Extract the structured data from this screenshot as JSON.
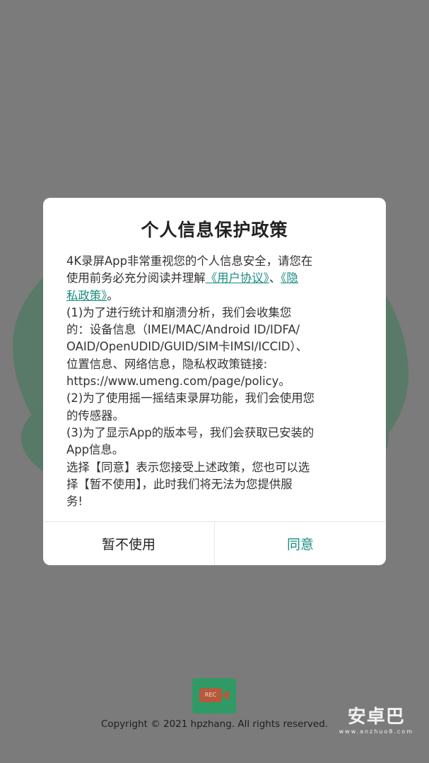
{
  "dialog": {
    "title": "个人信息保护政策",
    "body_lines": [
      {
        "parts": [
          {
            "text": "4K录屏App非常重视您的个人信息安全，请您在"
          }
        ]
      },
      {
        "parts": [
          {
            "text": "使用前务必充分阅读并理解"
          },
          {
            "text": "《用户协议》",
            "link": true
          },
          {
            "text": "、"
          },
          {
            "text": "《隐",
            "link": true
          }
        ]
      },
      {
        "parts": [
          {
            "text": "私政策》",
            "link": true
          },
          {
            "text": "。"
          }
        ]
      },
      {
        "parts": [
          {
            "text": "(1)为了进行统计和崩溃分析，我们会收集您"
          }
        ]
      },
      {
        "parts": [
          {
            "text": "的：设备信息（IMEI/MAC/Android ID/IDFA/"
          }
        ]
      },
      {
        "parts": [
          {
            "text": "OAID/OpenUDID/GUID/SIM卡IMSI/ICCID）、"
          }
        ]
      },
      {
        "parts": [
          {
            "text": "位置信息、网络信息，隐私权政策链接:"
          }
        ]
      },
      {
        "parts": [
          {
            "text": "https://www.umeng.com/page/policy。"
          }
        ]
      },
      {
        "parts": [
          {
            "text": "(2)为了使用摇一摇结束录屏功能，我们会使用您"
          }
        ]
      },
      {
        "parts": [
          {
            "text": "的传感器。"
          }
        ]
      },
      {
        "parts": [
          {
            "text": "(3)为了显示App的版本号，我们会获取已安装的"
          }
        ]
      },
      {
        "parts": [
          {
            "text": "App信息。"
          }
        ]
      },
      {
        "parts": [
          {
            "text": "选择【同意】表示您接受上述政策，您也可以选"
          }
        ]
      },
      {
        "parts": [
          {
            "text": "择【暂不使用】，此时我们将无法为您提供服"
          }
        ]
      },
      {
        "parts": [
          {
            "text": "务!"
          }
        ]
      }
    ],
    "cancel_label": "暂不使用",
    "agree_label": "同意"
  },
  "app_icon": {
    "label": "REC",
    "icon": "rec-camera-icon"
  },
  "copyright": "Copyright © 2021 hpzhang. All rights reserved.",
  "watermark": {
    "text": "安卓巴",
    "url": "www.anzhuo8.com"
  },
  "colors": {
    "accent": "#1b8c80",
    "overlay": "#7b7b7b",
    "icon_bg": "#2f9a66"
  }
}
